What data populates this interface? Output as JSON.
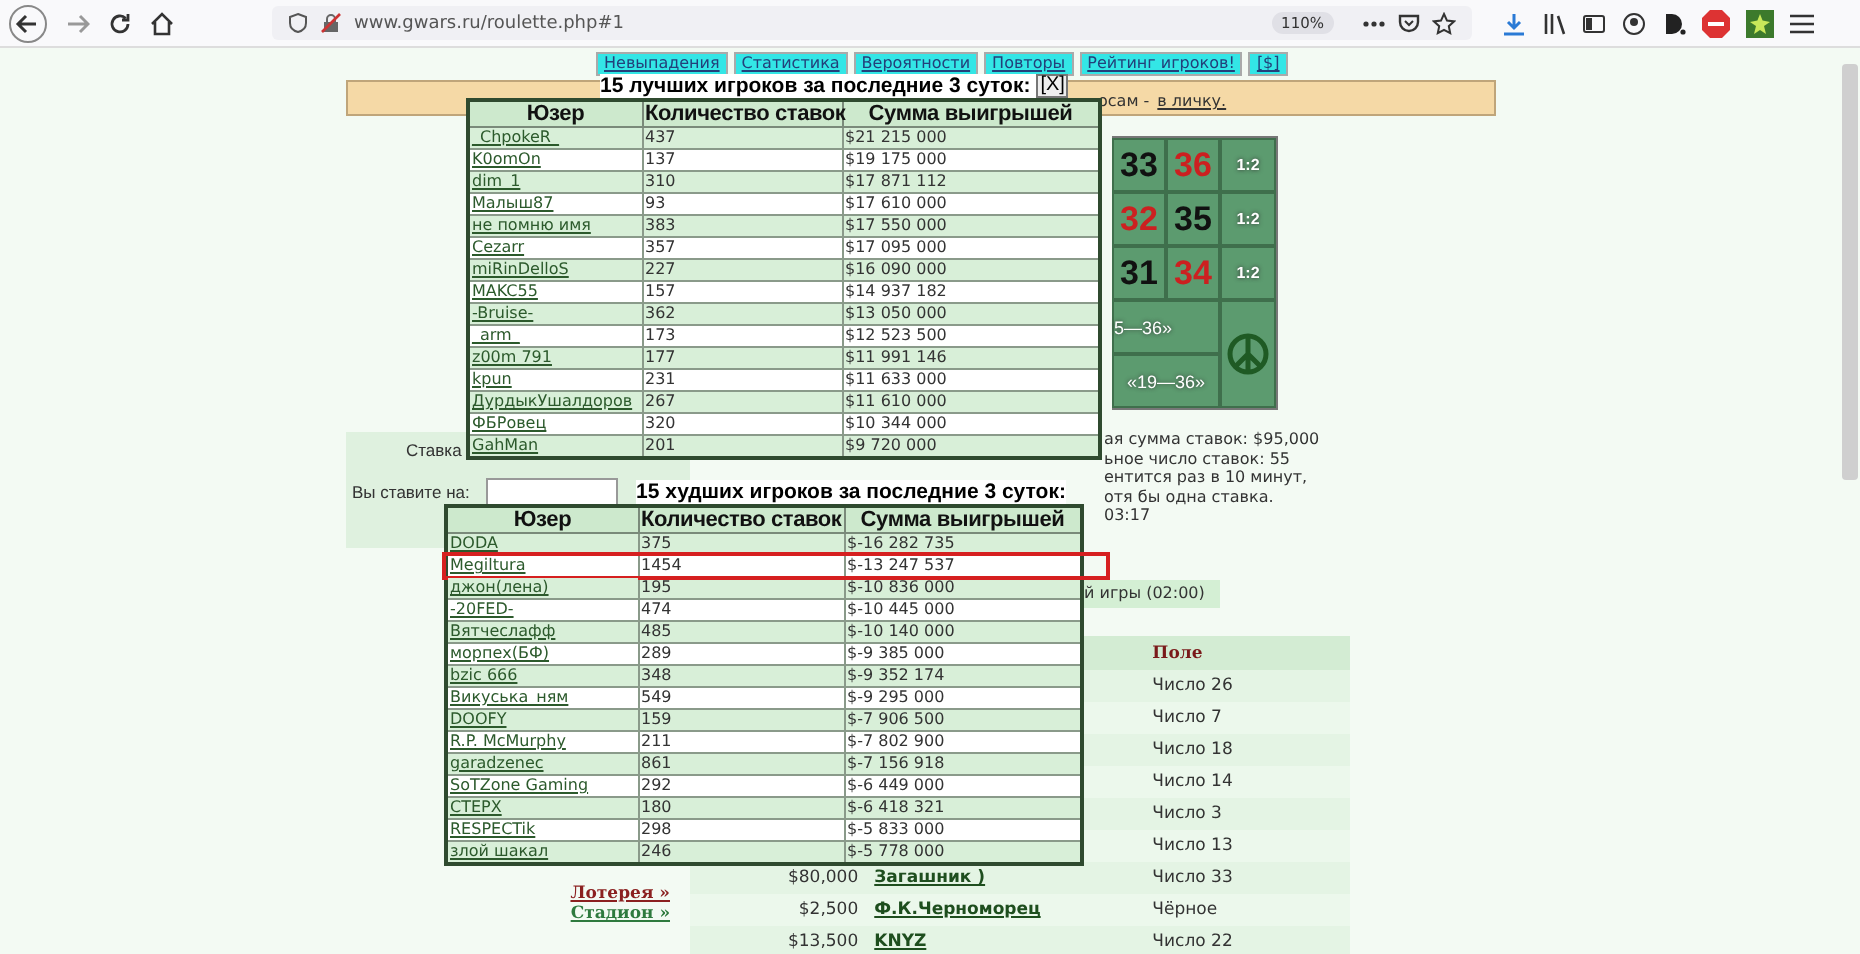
{
  "browser": {
    "url": "www.gwars.ru/roulette.php#1",
    "zoom": "110%"
  },
  "nav": [
    "Невыпадения",
    "Статистика",
    "Вероятности",
    "Повторы",
    "Рейтинг игроков!",
    "[$]"
  ],
  "banner": {
    "text": "осам -",
    "link": "в личку."
  },
  "roulette": {
    "rows": [
      {
        "numbers": [
          {
            "value": "33",
            "color": "#111111"
          },
          {
            "value": "36",
            "color": "#cc2020"
          }
        ],
        "payout": "1:2"
      },
      {
        "numbers": [
          {
            "value": "32",
            "color": "#cc2020"
          },
          {
            "value": "35",
            "color": "#111111"
          }
        ],
        "payout": "1:2"
      },
      {
        "numbers": [
          {
            "value": "31",
            "color": "#111111"
          },
          {
            "value": "34",
            "color": "#cc2020"
          }
        ],
        "payout": "1:2"
      }
    ],
    "dozens": [
      "5—36»",
      "«19—36»"
    ]
  },
  "bet_form": {
    "stake_label": "Ставка",
    "target_label": "Вы ставите на:"
  },
  "info": [
    "ая сумма ставок: $95,000",
    "ьное число ставок: 55",
    "ентится раз в 10 минут,",
    "отя бы одна ставка.",
    "03:17"
  ],
  "game_label": "й игры (02:00)",
  "side_links": [
    {
      "label": "Лотерея »",
      "color": "#8b2020"
    },
    {
      "label": "Стадион »",
      "color": "#2e7a3e"
    }
  ],
  "bets_table": {
    "header": "Поле",
    "rows": [
      {
        "field": "Число 26"
      },
      {
        "field": "Число 7"
      },
      {
        "field": "Число 18"
      },
      {
        "field": "Число 14"
      },
      {
        "field": "Число 3"
      },
      {
        "field": "Число 13"
      },
      {
        "amount": "$80,000",
        "user": "Загашник )",
        "field": "Число 33"
      },
      {
        "amount": "$2,500",
        "user": "Ф.К.Черноморец",
        "field": "Чёрное"
      },
      {
        "amount": "$13,500",
        "user": "KNYZ",
        "field": "Число 22"
      }
    ]
  },
  "best_players": {
    "title": "15 лучших игроков за последние 3 суток:",
    "close": "[X]",
    "columns": [
      "Юзер",
      "Количество ставок",
      "Сумма выигрышей"
    ],
    "rows": [
      {
        "user": "_ChpokeR_",
        "bets": "437",
        "sum": "$21 215 000"
      },
      {
        "user": "K0omOn",
        "bets": "137",
        "sum": "$19 175 000"
      },
      {
        "user": "dim_1",
        "bets": "310",
        "sum": "$17 871 112"
      },
      {
        "user": "Малыш87",
        "bets": "93",
        "sum": "$17 610 000"
      },
      {
        "user": "не помню имя",
        "bets": "383",
        "sum": "$17 550 000"
      },
      {
        "user": "Cezarr",
        "bets": "357",
        "sum": "$17 095 000"
      },
      {
        "user": "miRinDelloS",
        "bets": "227",
        "sum": "$16 090 000"
      },
      {
        "user": "MAKC55",
        "bets": "157",
        "sum": "$14 937 182"
      },
      {
        "user": "-Bruise-",
        "bets": "362",
        "sum": "$13 050 000"
      },
      {
        "user": "_arm_",
        "bets": "173",
        "sum": "$12 523 500"
      },
      {
        "user": "z00m 791",
        "bets": "177",
        "sum": "$11 991 146"
      },
      {
        "user": "kpun",
        "bets": "231",
        "sum": "$11 633 000"
      },
      {
        "user": "ДурдыкУшалдоров",
        "bets": "267",
        "sum": "$11 610 000"
      },
      {
        "user": "ФБРовец",
        "bets": "320",
        "sum": "$10 344 000"
      },
      {
        "user": "GahMan",
        "bets": "201",
        "sum": "$9 720 000"
      }
    ]
  },
  "worst_players": {
    "title": "15 худших игроков за последние 3 суток:",
    "columns": [
      "Юзер",
      "Количество ставок",
      "Сумма выигрышей"
    ],
    "rows": [
      {
        "user": "DODA",
        "bets": "375",
        "sum": "$-16 282 735",
        "highlighted": false
      },
      {
        "user": "Megiltura",
        "bets": "1454",
        "sum": "$-13 247 537",
        "highlighted": true
      },
      {
        "user": "джон(лена)",
        "bets": "195",
        "sum": "$-10 836 000",
        "highlighted": false
      },
      {
        "user": "-20FED-",
        "bets": "474",
        "sum": "$-10 445 000",
        "highlighted": false
      },
      {
        "user": "Вятчеслафф",
        "bets": "485",
        "sum": "$-10 140 000",
        "highlighted": false
      },
      {
        "user": "морпех(БФ)",
        "bets": "289",
        "sum": "$-9 385 000",
        "highlighted": false
      },
      {
        "user": "bzic 666",
        "bets": "348",
        "sum": "$-9 352 174",
        "highlighted": false
      },
      {
        "user": "Викуська_ням",
        "bets": "549",
        "sum": "$-9 295 000",
        "highlighted": false
      },
      {
        "user": "DOOFY",
        "bets": "159",
        "sum": "$-7 906 500",
        "highlighted": false
      },
      {
        "user": "R.P. McMurphy",
        "bets": "211",
        "sum": "$-7 802 900",
        "highlighted": false
      },
      {
        "user": "garadzenec",
        "bets": "861",
        "sum": "$-7 156 918",
        "highlighted": false
      },
      {
        "user": "SoTZone Gaming",
        "bets": "292",
        "sum": "$-6 449 000",
        "highlighted": false
      },
      {
        "user": "CTEPX",
        "bets": "180",
        "sum": "$-6 418 321",
        "highlighted": false
      },
      {
        "user": "RESPECTik",
        "bets": "298",
        "sum": "$-5 833 000",
        "highlighted": false
      },
      {
        "user": "злой шакал",
        "bets": "246",
        "sum": "$-5 778 000",
        "highlighted": false
      }
    ]
  }
}
